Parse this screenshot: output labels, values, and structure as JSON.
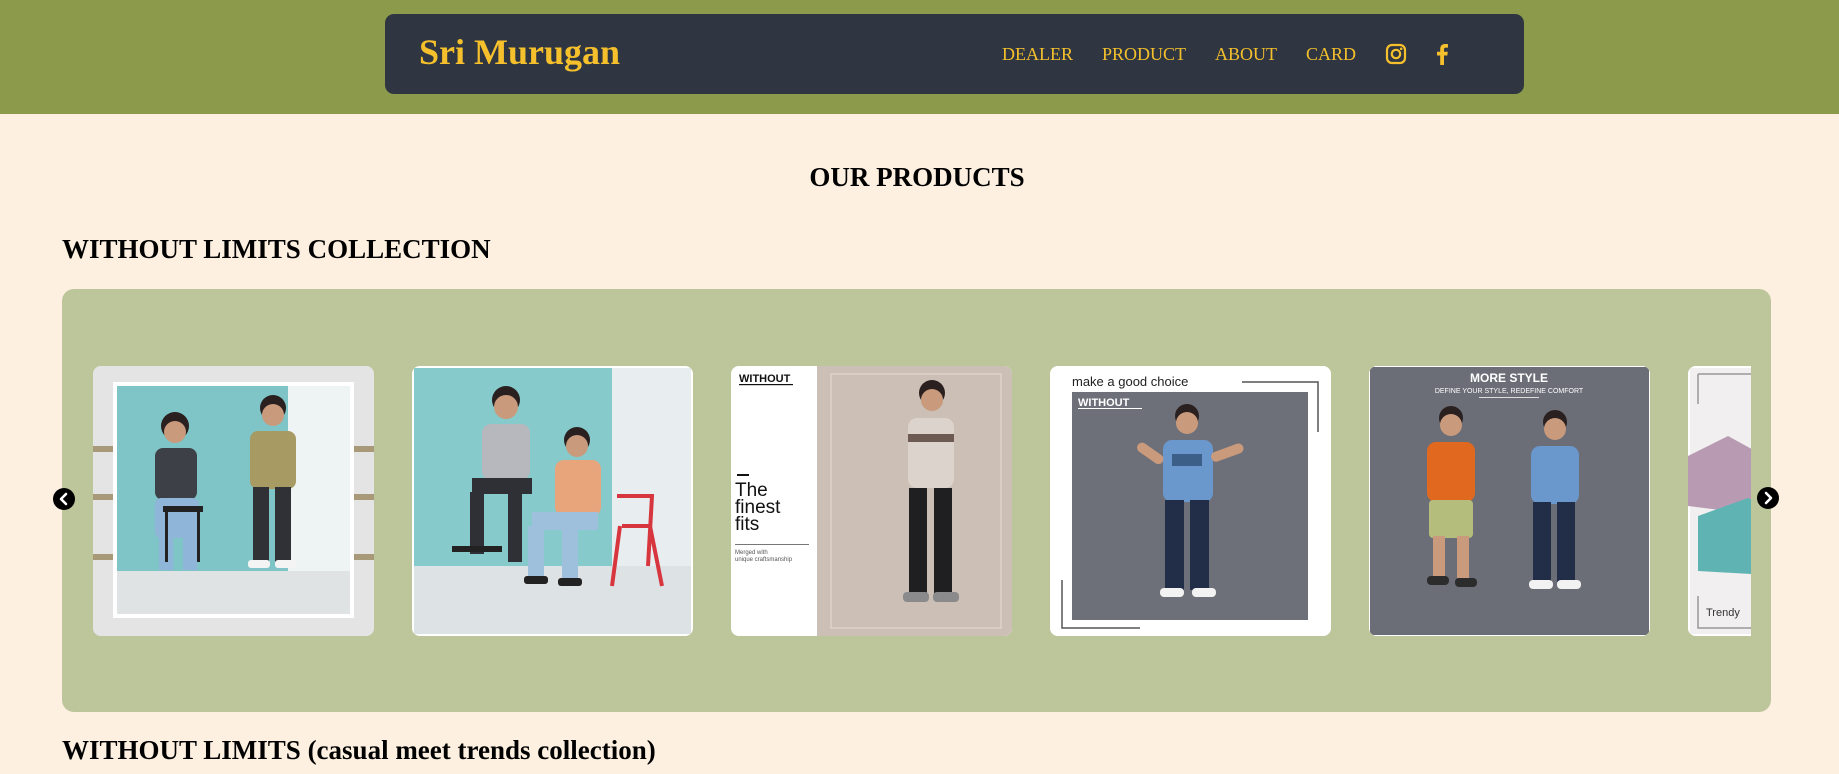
{
  "brand": "Sri Murugan",
  "nav": [
    "DEALER",
    "PRODUCT",
    "ABOUT",
    "CARD"
  ],
  "social_icons": [
    "instagram-icon",
    "facebook-icon"
  ],
  "page_heading": "OUR PRODUCTS",
  "sections": [
    {
      "title": "WITHOUT LIMITS COLLECTION"
    },
    {
      "title": "WITHOUT LIMITS (casual meet trends collection)"
    }
  ],
  "cards": [
    {
      "kind": "photo"
    },
    {
      "kind": "photo"
    },
    {
      "kind": "ad",
      "logo": "WITHOUT",
      "headline": [
        "The",
        "finest",
        "fits"
      ],
      "small": [
        "Merged with",
        "unique craftsmanship"
      ]
    },
    {
      "kind": "ad",
      "tagline": "make a good choice",
      "logo": "WITHOUT"
    },
    {
      "kind": "ad",
      "headline": [
        "MORE STYLE"
      ],
      "small": [
        "DEFINE YOUR STYLE, REDEFINE COMFORT"
      ]
    },
    {
      "kind": "ad",
      "small": [
        "Trendy"
      ]
    }
  ],
  "colors": {
    "page_bg": "#fdf0e0",
    "header_band": "#8b9a4b",
    "navbar": "#2f3641",
    "accent": "#f5c02c",
    "carousel_bg": "#bdc59b"
  }
}
